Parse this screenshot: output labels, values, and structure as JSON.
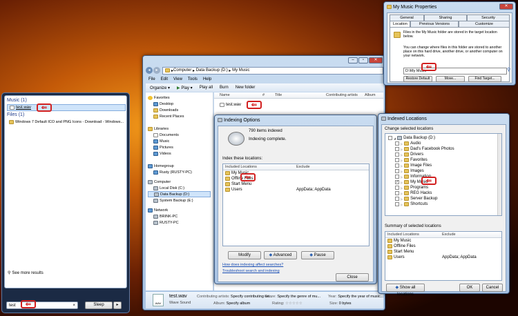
{
  "start_menu": {
    "music_header": "Music (1)",
    "music_result": "test.wav",
    "files_header": "Files (1)",
    "files_result": "Windows 7 Default ICO and PNG Icons - Download - Windows...",
    "see_more": "See more results",
    "search_value": "test",
    "sleep_label": "Sleep"
  },
  "explorer": {
    "breadcrumb": [
      "Computer",
      "Data Backup (D:)",
      "My Music"
    ],
    "menu": [
      "File",
      "Edit",
      "View",
      "Tools",
      "Help"
    ],
    "toolbar": {
      "organize": "Organize",
      "play": "Play",
      "play_all": "Play all",
      "burn": "Burn",
      "new_folder": "New folder"
    },
    "columns": [
      "Name",
      "#",
      "Title",
      "Contributing artists",
      "Album"
    ],
    "file_name": "test.wav",
    "nav": {
      "favorites": "Favorites",
      "desktop": "Desktop",
      "downloads": "Downloads",
      "recent": "Recent Places",
      "libraries": "Libraries",
      "documents": "Documents",
      "music": "Music",
      "pictures": "Pictures",
      "videos": "Videos",
      "homegroup": "Homegroup",
      "rusty": "Rusty (RUSTY-PC)",
      "computer": "Computer",
      "local_disk": "Local Disk (C:)",
      "data_backup": "Data Backup (D:)",
      "system_backup": "System Backup (E:)",
      "network": "Network",
      "brink": "BRINK-PC",
      "rustypc": "RUSTY-PC"
    },
    "details": {
      "name": "test.wav",
      "type": "Wave Sound",
      "contrib_label": "Contributing artists:",
      "contrib_value": "Specify contributing art...",
      "genre_label": "Genre:",
      "genre_value": "Specify the genre of mu...",
      "year_label": "Year:",
      "year_value": "Specify the year of music...",
      "album_label": "Album:",
      "album_value": "Specify album",
      "rating_label": "Rating:",
      "rating_stars": "☆☆☆☆☆",
      "size_label": "Size:",
      "size_value": "0 bytes"
    }
  },
  "indexing": {
    "title": "Indexing Options",
    "items_indexed": "790 items indexed",
    "status": "Indexing complete.",
    "index_these": "Index these locations:",
    "col_included": "Included Locations",
    "col_exclude": "Exclude",
    "locations": [
      {
        "name": "My Music",
        "exclude": ""
      },
      {
        "name": "Offline Files",
        "exclude": ""
      },
      {
        "name": "Start Menu",
        "exclude": ""
      },
      {
        "name": "Users",
        "exclude": "AppData; AppData"
      }
    ],
    "modify": "Modify",
    "advanced": "Advanced",
    "pause": "Pause",
    "link1": "How does indexing affect searches?",
    "link2": "Troubleshoot search and indexing",
    "close": "Close"
  },
  "indexed_locations": {
    "title": "Indexed Locations",
    "change_label": "Change selected locations",
    "tree": [
      {
        "name": "Data Backup (D:)",
        "checked": false,
        "level": 0,
        "drive": true
      },
      {
        "name": "Audio",
        "checked": false,
        "level": 1
      },
      {
        "name": "Dad's Facebook Photos",
        "checked": false,
        "level": 1
      },
      {
        "name": "Drivers",
        "checked": false,
        "level": 1
      },
      {
        "name": "Favorites",
        "checked": false,
        "level": 1
      },
      {
        "name": "Image Files",
        "checked": false,
        "level": 1
      },
      {
        "name": "Images",
        "checked": false,
        "level": 1
      },
      {
        "name": "Information",
        "checked": false,
        "level": 1
      },
      {
        "name": "My Music",
        "checked": true,
        "level": 1
      },
      {
        "name": "Programs",
        "checked": false,
        "level": 1
      },
      {
        "name": "REG Hacks",
        "checked": false,
        "level": 1
      },
      {
        "name": "Server Backup",
        "checked": false,
        "level": 1
      },
      {
        "name": "Shortcuts",
        "checked": false,
        "level": 1
      }
    ],
    "summary_label": "Summary of selected locations",
    "col_included": "Included Locations",
    "col_exclude": "Exclude",
    "summary": [
      {
        "name": "My Music",
        "exclude": ""
      },
      {
        "name": "Offline Files",
        "exclude": ""
      },
      {
        "name": "Start Menu",
        "exclude": ""
      },
      {
        "name": "Users",
        "exclude": "AppData; AppData"
      }
    ],
    "show_all": "Show all locations",
    "ok": "OK",
    "cancel": "Cancel"
  },
  "properties": {
    "title": "My Music Properties",
    "tabs_row1": [
      "General",
      "Sharing",
      "Security"
    ],
    "tabs_row2": [
      "Location",
      "Previous Versions",
      "Customize"
    ],
    "text1": "Files in the My Music folder are stored in the target location below.",
    "text2": "You can change where files in this folder are stored to another place on this hard drive, another drive, or another computer on your network.",
    "path": "D:\\My Music",
    "restore": "Restore Default",
    "move": "Move...",
    "find": "Find Target..."
  }
}
